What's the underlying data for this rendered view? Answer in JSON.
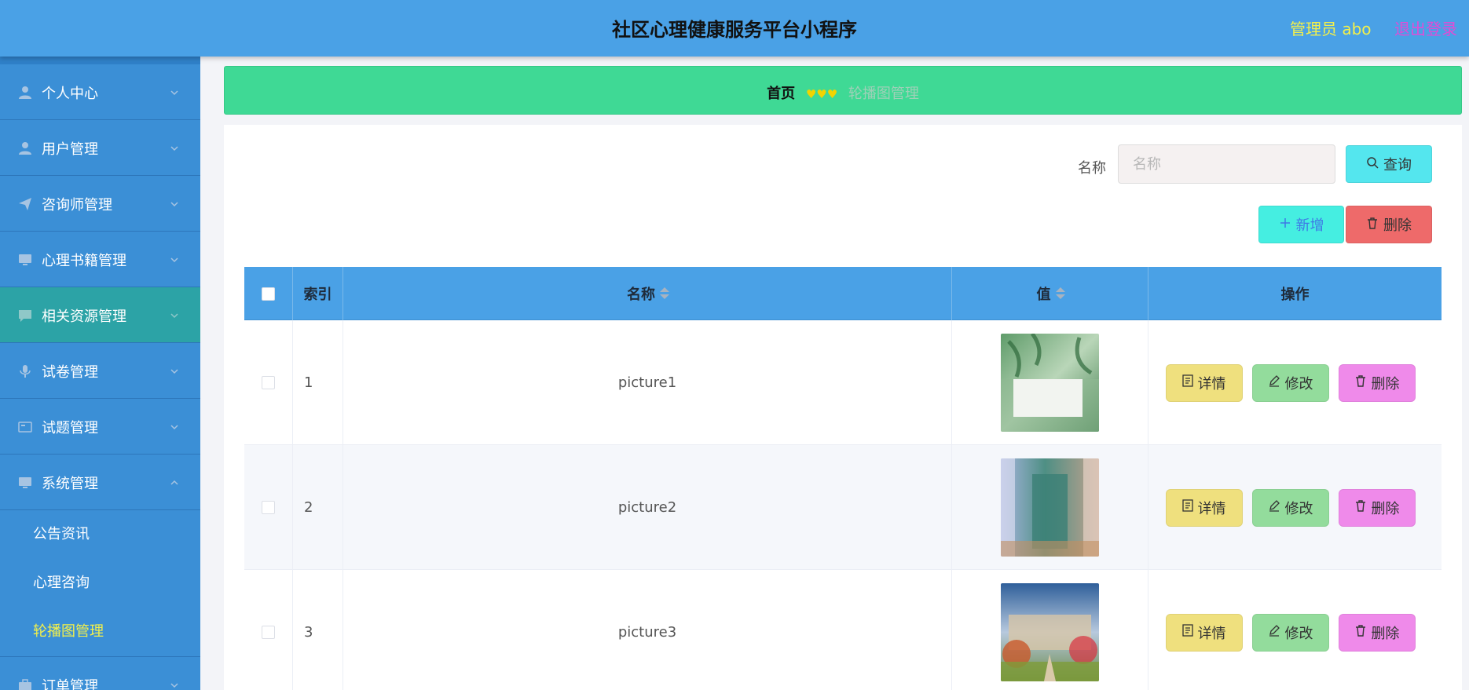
{
  "header": {
    "title": "社区心理健康服务平台小程序",
    "admin_label": "管理员 abo",
    "logout_label": "退出登录"
  },
  "sidebar": {
    "items": [
      {
        "label": "个人中心",
        "icon": "person-icon",
        "expanded": false
      },
      {
        "label": "用户管理",
        "icon": "person-icon",
        "expanded": false
      },
      {
        "label": "咨询师管理",
        "icon": "send-icon",
        "expanded": false
      },
      {
        "label": "心理书籍管理",
        "icon": "monitor-icon",
        "expanded": false
      },
      {
        "label": "相关资源管理",
        "icon": "chat-icon",
        "expanded": false
      },
      {
        "label": "试卷管理",
        "icon": "microphone-icon",
        "expanded": false
      },
      {
        "label": "试题管理",
        "icon": "card-icon",
        "expanded": false
      },
      {
        "label": "系统管理",
        "icon": "monitor-icon",
        "expanded": true
      },
      {
        "label": "订单管理",
        "icon": "briefcase-icon",
        "expanded": false
      }
    ],
    "submenu": [
      {
        "label": "公告资讯",
        "active": false
      },
      {
        "label": "心理咨询",
        "active": false
      },
      {
        "label": "轮播图管理",
        "active": true
      }
    ]
  },
  "breadcrumb": {
    "home": "首页",
    "separator": "♥♥♥",
    "current": "轮播图管理"
  },
  "search": {
    "label": "名称",
    "placeholder": "名称",
    "query_label": "查询"
  },
  "actions": {
    "add_label": "新增",
    "delete_label": "删除"
  },
  "table": {
    "columns": [
      "",
      "索引",
      "名称",
      "值",
      "操作"
    ],
    "rows": [
      {
        "index": "1",
        "name": "picture1",
        "image": "green-leaves-life"
      },
      {
        "index": "2",
        "name": "picture2",
        "image": "school-building-doorway"
      },
      {
        "index": "3",
        "name": "picture3",
        "image": "campus-garden"
      }
    ],
    "row_actions": {
      "detail": "详情",
      "edit": "修改",
      "remove": "删除"
    }
  },
  "colors": {
    "header_bg": "#4aa1e6",
    "sidebar_bg": "#3b8fd6",
    "breadcrumb_bg": "#3fd995",
    "accent_yellow": "#f3f04a",
    "logout_pink": "#e14cd6"
  }
}
